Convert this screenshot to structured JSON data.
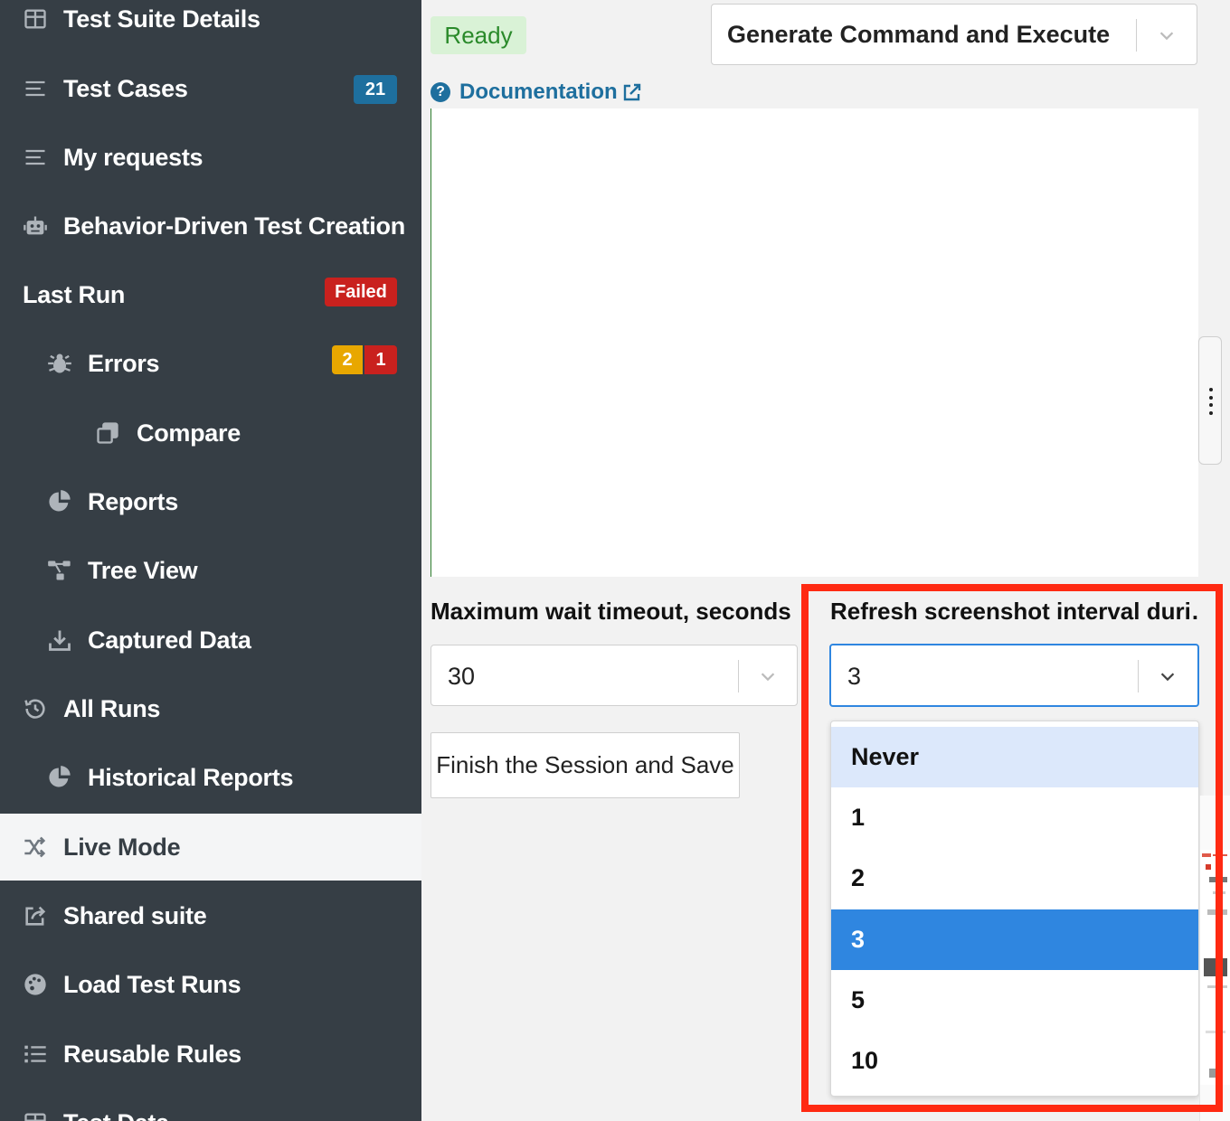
{
  "sidebar": {
    "items": [
      {
        "label": "Test Suite Details",
        "icon": "table-icon"
      },
      {
        "label": "Test Cases",
        "icon": "list-icon",
        "badge": "21"
      },
      {
        "label": "My requests",
        "icon": "list-icon"
      },
      {
        "label": "Behavior-Driven Test Creation",
        "icon": "robot-icon"
      },
      {
        "label": "Last Run",
        "badge": "Failed"
      },
      {
        "label": "Errors",
        "icon": "bug-icon",
        "badge_warn": "2",
        "badge_err": "1"
      },
      {
        "label": "Compare",
        "icon": "copy-icon"
      },
      {
        "label": "Reports",
        "icon": "pie-chart-icon"
      },
      {
        "label": "Tree View",
        "icon": "tree-icon"
      },
      {
        "label": "Captured Data",
        "icon": "download-icon"
      },
      {
        "label": "All Runs",
        "icon": "history-icon"
      },
      {
        "label": "Historical Reports",
        "icon": "pie-chart-icon"
      },
      {
        "label": "Live Mode",
        "icon": "shuffle-icon",
        "active": true
      },
      {
        "label": "Shared suite",
        "icon": "share-icon"
      },
      {
        "label": "Load Test Runs",
        "icon": "palette-icon"
      },
      {
        "label": "Reusable Rules",
        "icon": "list-ul-icon"
      },
      {
        "label": "Test Data",
        "icon": "table-icon"
      }
    ]
  },
  "main": {
    "status": "Ready",
    "command_select": "Generate Command and Execute",
    "documentation_link": "Documentation",
    "timeout": {
      "label": "Maximum wait timeout, seconds:",
      "value": "30"
    },
    "refresh": {
      "label": "Refresh screenshot interval duri…",
      "value": "3",
      "options": [
        "Never",
        "1",
        "2",
        "3",
        "5",
        "10"
      ],
      "hovered": "Never",
      "selected": "3"
    },
    "finish_button": "Finish the Session and Save"
  },
  "colors": {
    "sidebar_bg": "#363e45",
    "accent_blue": "#1e6f9e",
    "failed_red": "#c9211e",
    "warning_yellow": "#e8a700",
    "ready_green_bg": "#d9f2d6",
    "highlight_red": "#ff2a12",
    "select_blue": "#2f86e0"
  }
}
